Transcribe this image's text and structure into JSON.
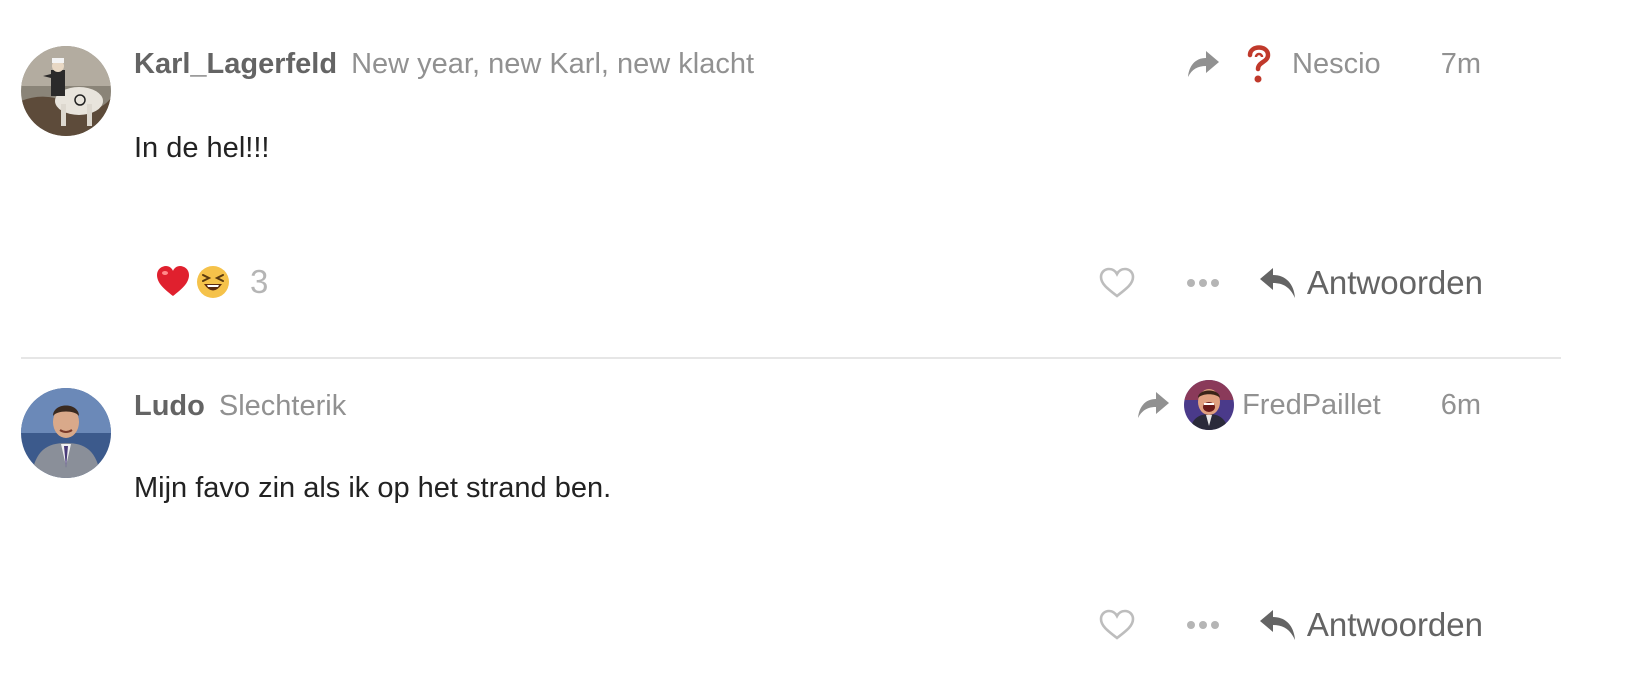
{
  "posts": [
    {
      "username": "Karl_Lagerfeld",
      "full_name": "New year, new Karl, new klacht",
      "reply_to_user": "Nescio",
      "time": "7m",
      "content": "In de hel!!!",
      "reactions": {
        "emojis": [
          "heart",
          "laughing"
        ],
        "count": "3"
      },
      "reply_label": "Antwoorden"
    },
    {
      "username": "Ludo",
      "full_name": "Slechterik",
      "reply_to_user": "FredPaillet",
      "time": "6m",
      "content": "Mijn favo zin als ik op het strand ben.",
      "reply_label": "Antwoorden"
    }
  ],
  "icons": {
    "reply_to": "share-arrow-icon",
    "like": "heart-outline-icon",
    "more": "ellipsis-icon",
    "reply": "reply-arrow-icon"
  },
  "colors": {
    "username": "#646464",
    "secondary": "#919191",
    "body_text": "#222222",
    "divider": "#e6e6e6",
    "reaction_count": "#b5b5b5"
  }
}
